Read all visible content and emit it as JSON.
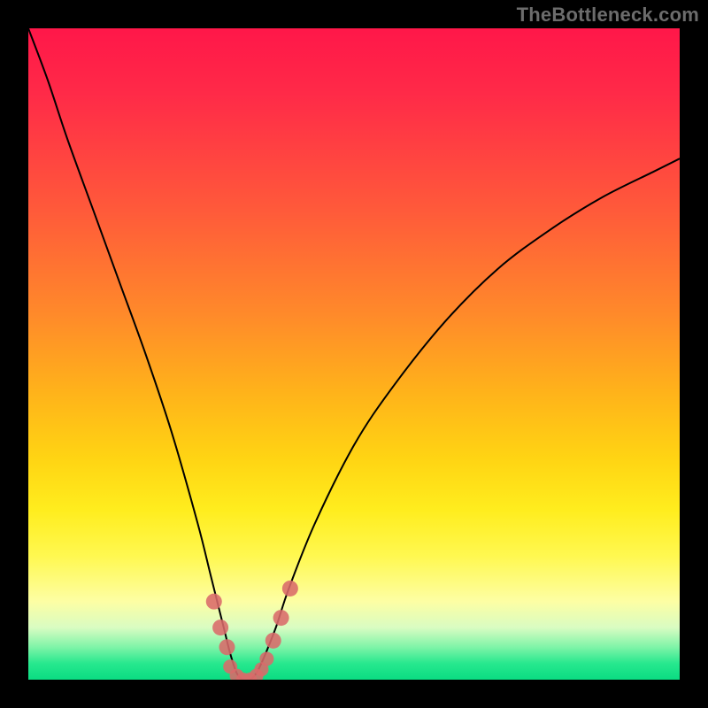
{
  "watermark": {
    "text": "TheBottleneck.com"
  },
  "chart_data": {
    "type": "line",
    "title": "",
    "xlabel": "",
    "ylabel": "",
    "xlim": [
      0,
      100
    ],
    "ylim": [
      0,
      100
    ],
    "grid": false,
    "series": [
      {
        "name": "main-curve",
        "color": "#000000",
        "x": [
          0,
          3,
          6,
          10,
          14,
          18,
          22,
          26,
          28,
          30,
          31,
          32,
          33,
          34,
          35,
          36,
          38,
          40,
          44,
          50,
          56,
          64,
          72,
          80,
          88,
          96,
          100
        ],
        "y": [
          100,
          92,
          83,
          72,
          61,
          50,
          38,
          24,
          16,
          8,
          4,
          1,
          0,
          0,
          1,
          3,
          8,
          14,
          24,
          36,
          45,
          55,
          63,
          69,
          74,
          78,
          80
        ]
      },
      {
        "name": "markers-left",
        "type": "scatter",
        "color": "#d96a6a",
        "x": [
          28.5,
          29.5,
          30.5
        ],
        "y": [
          12,
          8,
          5
        ]
      },
      {
        "name": "markers-bottom",
        "type": "scatter",
        "color": "#d96a6a",
        "x": [
          31,
          32,
          33,
          34,
          35,
          35.8,
          36.6
        ],
        "y": [
          2,
          0.6,
          0,
          0,
          0.6,
          1.6,
          3.2
        ]
      },
      {
        "name": "markers-right",
        "type": "scatter",
        "color": "#d96a6a",
        "x": [
          37.6,
          38.8,
          40.2
        ],
        "y": [
          6,
          9.5,
          14
        ]
      }
    ],
    "background_gradient": {
      "top": "#ff1749",
      "mid1": "#ff8a2a",
      "mid2": "#ffed1e",
      "bottom": "#0bdc82"
    }
  }
}
